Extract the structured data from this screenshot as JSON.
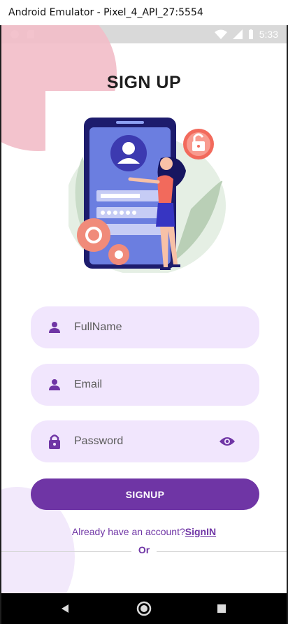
{
  "window": {
    "title": "Android Emulator - Pixel_4_API_27:5554"
  },
  "status_bar": {
    "time": "5:33"
  },
  "screen": {
    "title": "SIGN UP",
    "fields": {
      "fullname_placeholder": "FullName",
      "email_placeholder": "Email",
      "password_placeholder": "Password"
    },
    "signup_button": "SIGNUP",
    "already_text": "Already have an account?",
    "signin_link": "SignIN",
    "or_text": "Or"
  },
  "colors": {
    "primary": "#6f35a5",
    "field_bg": "#f1e6fd",
    "pink_blob": "#f2bcc8",
    "purple_blob": "#f2e9fb"
  },
  "icons": [
    "person-icon",
    "lock-icon",
    "eye-icon",
    "back-icon",
    "home-icon",
    "recents-icon",
    "wifi-icon",
    "signal-icon",
    "battery-icon"
  ]
}
